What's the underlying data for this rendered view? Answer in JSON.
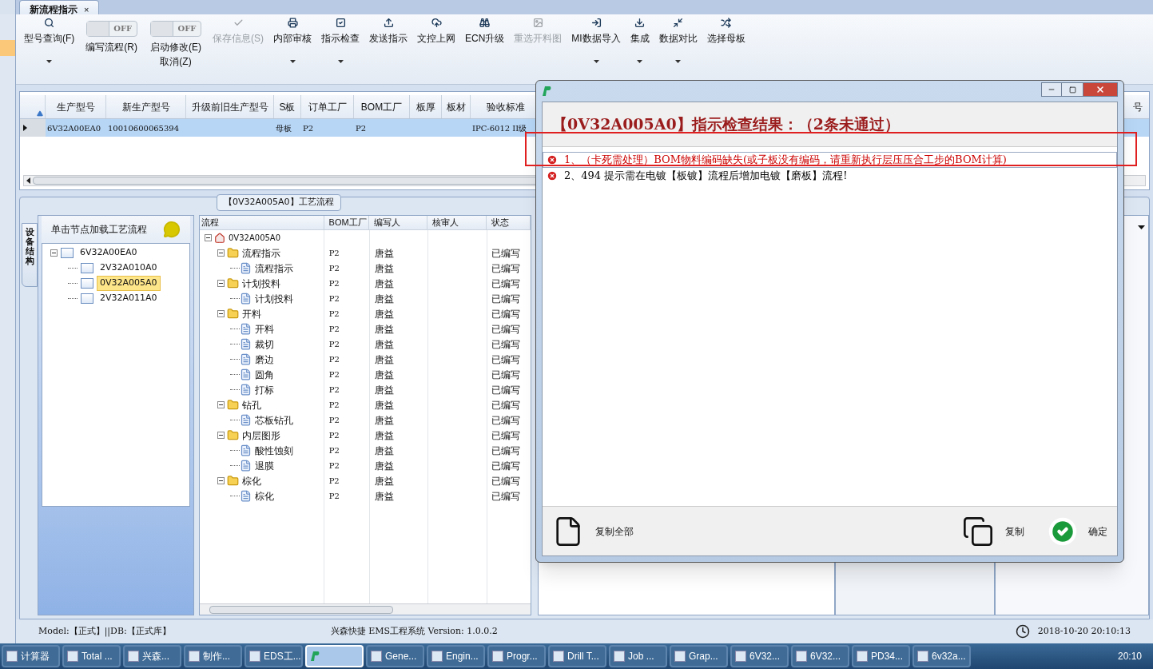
{
  "document_tab": {
    "title": "新流程指示",
    "close": "×"
  },
  "toolbar": [
    {
      "kind": "button",
      "label": "型号查询(F)",
      "disabled": false,
      "dropdown": true
    },
    {
      "kind": "toggle",
      "label": "编写流程(R)",
      "on": false,
      "state_text": "OFF"
    },
    {
      "kind": "toggle",
      "label": "启动修改(E)",
      "label2": "取消(Z)",
      "on": false,
      "state_text": "OFF"
    },
    {
      "kind": "button",
      "label": "保存信息(S)",
      "disabled": true,
      "dropdown": false
    },
    {
      "kind": "button",
      "label": "内部审核",
      "disabled": false,
      "dropdown": true
    },
    {
      "kind": "button",
      "label": "指示检查",
      "disabled": false,
      "dropdown": true
    },
    {
      "kind": "button",
      "label": "发送指示",
      "disabled": false,
      "dropdown": false
    },
    {
      "kind": "button",
      "label": "文控上网",
      "disabled": false,
      "dropdown": false
    },
    {
      "kind": "button",
      "label": "ECN升级",
      "disabled": false,
      "dropdown": false
    },
    {
      "kind": "button",
      "label": "重选开料图",
      "disabled": true,
      "dropdown": false
    },
    {
      "kind": "button",
      "label": "MI数据导入",
      "disabled": false,
      "dropdown": true
    },
    {
      "kind": "button",
      "label": "集成",
      "disabled": false,
      "dropdown": true
    },
    {
      "kind": "button",
      "label": "数据对比",
      "disabled": false,
      "dropdown": true
    },
    {
      "kind": "button",
      "label": "选择母板",
      "disabled": false,
      "dropdown": false
    }
  ],
  "grid": {
    "columns": [
      "生产型号",
      "新生产型号",
      "升级前旧生产型号",
      "S板",
      "订单工厂",
      "BOM工厂",
      "板厚",
      "板材",
      "验收标准",
      "号"
    ],
    "rows": [
      {
        "selected": true,
        "cells": [
          "6V32A00EA0",
          "10010600065394",
          "",
          "母板",
          "P2",
          "P2",
          "",
          "",
          "IPC-6012 II级",
          ""
        ]
      }
    ]
  },
  "process_group": {
    "title": "【0V32A005A0】工艺流程",
    "side_tab": "设备结构",
    "panel_header": "单击节点加载工艺流程",
    "structure_tree": [
      {
        "label": "6V32A00EA0",
        "selected": false,
        "expanded": true,
        "children": [
          {
            "label": "2V32A010A0",
            "selected": false
          },
          {
            "label": "0V32A005A0",
            "selected": true
          },
          {
            "label": "2V32A011A0",
            "selected": false
          }
        ]
      }
    ],
    "flow_columns": [
      "流程",
      "BOM工厂",
      "编写人",
      "核审人",
      "状态"
    ],
    "flow_tree": [
      {
        "kind": "root",
        "name": "0V32A005A0",
        "expanded": true,
        "children": [
          {
            "kind": "folder",
            "name": "流程指示",
            "factory": "P2",
            "writer": "唐益",
            "status": "已编写",
            "expanded": true,
            "children": [
              {
                "kind": "step",
                "name": "流程指示",
                "factory": "P2",
                "writer": "唐益",
                "status": "已编写"
              }
            ]
          },
          {
            "kind": "folder",
            "name": "计划投料",
            "factory": "P2",
            "writer": "唐益",
            "status": "已编写",
            "expanded": true,
            "children": [
              {
                "kind": "step",
                "name": "计划投料",
                "factory": "P2",
                "writer": "唐益",
                "status": "已编写"
              }
            ]
          },
          {
            "kind": "folder",
            "name": "开料",
            "factory": "P2",
            "writer": "唐益",
            "status": "已编写",
            "expanded": true,
            "children": [
              {
                "kind": "step",
                "name": "开料",
                "factory": "P2",
                "writer": "唐益",
                "status": "已编写"
              },
              {
                "kind": "step",
                "name": "裁切",
                "factory": "P2",
                "writer": "唐益",
                "status": "已编写"
              },
              {
                "kind": "step",
                "name": "磨边",
                "factory": "P2",
                "writer": "唐益",
                "status": "已编写"
              },
              {
                "kind": "step",
                "name": "圆角",
                "factory": "P2",
                "writer": "唐益",
                "status": "已编写"
              },
              {
                "kind": "step",
                "name": "打标",
                "factory": "P2",
                "writer": "唐益",
                "status": "已编写"
              }
            ]
          },
          {
            "kind": "folder",
            "name": "钻孔",
            "factory": "P2",
            "writer": "唐益",
            "status": "已编写",
            "expanded": true,
            "children": [
              {
                "kind": "step",
                "name": "芯板钻孔",
                "factory": "P2",
                "writer": "唐益",
                "status": "已编写"
              }
            ]
          },
          {
            "kind": "folder",
            "name": "内层图形",
            "factory": "P2",
            "writer": "唐益",
            "status": "已编写",
            "expanded": true,
            "children": [
              {
                "kind": "step",
                "name": "酸性蚀刻",
                "factory": "P2",
                "writer": "唐益",
                "status": "已编写"
              },
              {
                "kind": "step",
                "name": "退膜",
                "factory": "P2",
                "writer": "唐益",
                "status": "已编写"
              }
            ]
          },
          {
            "kind": "folder",
            "name": "棕化",
            "factory": "P2",
            "writer": "唐益",
            "status": "已编写",
            "expanded": true,
            "children": [
              {
                "kind": "step",
                "name": "棕化",
                "factory": "P2",
                "writer": "唐益",
                "status": "已编写"
              }
            ]
          }
        ]
      }
    ]
  },
  "dialog": {
    "heading": "【0V32A005A0】指示检查结果：（2条未通过）",
    "messages": [
      {
        "text": "1、（卡死需处理）BOM物料编码缺失(或子板没有编码，请重新执行层压压合工步的BOM计算)",
        "color": "#cc0000",
        "selected": true,
        "highlighted": true
      },
      {
        "text": "2、494 提示需在电镀【板镀】流程后增加电镀【磨板】流程!",
        "color": "#000000",
        "selected": false,
        "highlighted": false
      }
    ],
    "buttons": [
      {
        "kind": "copy_all",
        "label": "复制全部"
      },
      {
        "kind": "copy",
        "label": "复制"
      },
      {
        "kind": "ok",
        "label": "确定"
      }
    ]
  },
  "status_bar": {
    "left": "Model:【正式】||DB:【正式库】",
    "center": "兴森快捷 EMS工程系统 Version: 1.0.0.2",
    "datetime": "2018-10-20 20:10:13"
  },
  "taskbar": {
    "items": [
      {
        "label": "计算器",
        "active": false
      },
      {
        "label": "Total ...",
        "active": false
      },
      {
        "label": "兴森...",
        "active": false
      },
      {
        "label": "制作...",
        "active": false
      },
      {
        "label": "EDS工...",
        "active": false
      },
      {
        "active": true
      },
      {
        "label": "Gene...",
        "active": false
      },
      {
        "label": "Engin...",
        "active": false
      },
      {
        "label": "Progr...",
        "active": false
      },
      {
        "label": "Drill T...",
        "active": false
      },
      {
        "label": "Job ...",
        "active": false
      },
      {
        "label": "Grap...",
        "active": false
      },
      {
        "label": "6V32...",
        "active": false
      },
      {
        "label": "6V32...",
        "active": false
      },
      {
        "label": "PD34...",
        "active": false
      },
      {
        "label": "6v32a...",
        "active": false
      }
    ],
    "time": "20:10"
  }
}
